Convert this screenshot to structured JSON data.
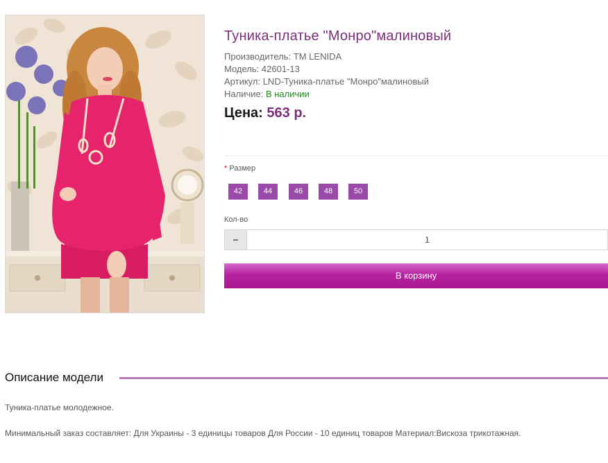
{
  "product": {
    "title": "Туника-платье \"Монро\"малиновый",
    "manufacturer_label": "Производитель:",
    "manufacturer": "ТМ LENIDA",
    "model_label": "Модель:",
    "model": "42601-13",
    "sku_label": "Артикул:",
    "sku": "LND-Туника-платье \"Монро\"малиновый",
    "availability_label": "Наличие:",
    "availability": "В наличии",
    "price_label": "Цена:",
    "price": "563 р."
  },
  "options": {
    "size_required_mark": "*",
    "size_label": "Размер",
    "sizes": [
      "42",
      "44",
      "46",
      "48",
      "50"
    ],
    "qty_label": "Кол-во",
    "qty_minus": "−",
    "qty_value": "1",
    "cart_button": "В корзину"
  },
  "description": {
    "heading": "Описание модели",
    "paragraphs": [
      "Туника-платье молодежное.",
      "Минимальный заказ составляет: Для Украины - 3 единицы товаров Для России - 10 единиц товаров Материал:Вискоза трикотажная."
    ]
  },
  "colors": {
    "accent": "#7a2f7a",
    "size_button": "#9a4aa8",
    "cart_button": "#b6239f",
    "in_stock": "#1d8a1d"
  }
}
